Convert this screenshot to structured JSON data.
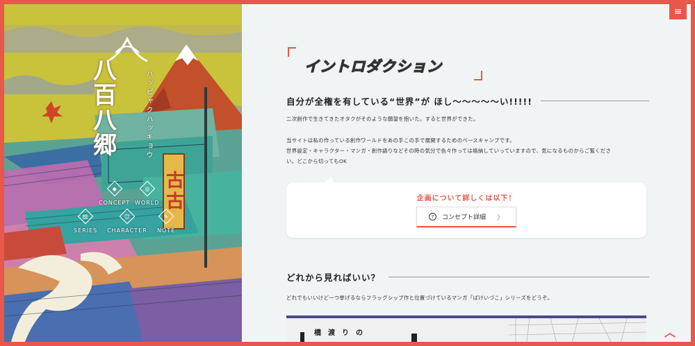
{
  "site": {
    "logo_title": "八百八郷",
    "logo_subtitle": "ぶらり創作徒然記",
    "logo_reading": "ハッピャクハッキョウ"
  },
  "nav": {
    "items": [
      {
        "label": "CONCEPT",
        "icon": "concept-icon"
      },
      {
        "label": "WORLD",
        "icon": "world-icon"
      },
      {
        "label": "SERIES",
        "icon": "series-icon"
      },
      {
        "label": "CHARACTER",
        "icon": "character-icon"
      },
      {
        "label": "NOTE",
        "icon": "note-icon"
      }
    ],
    "menu_icon": "≡"
  },
  "art": {
    "sign_text": "古古"
  },
  "main": {
    "page_title": "イントロダクション",
    "section1": {
      "heading": "自分が全権を有している“世界”が ほし～～～～～い!!!!!",
      "p1": "二次創作で生きてきたオタクがそのような願望を抱いた。すると世界ができた。",
      "p2a": "当サイトは私の作っている創作ワールドをあの手この手で展開するためのベースキャンプです。",
      "p2b": "世界設定・キャラクター・マンガ・創作語りなどその時の気分で色々作っては格納していっていますので、気になるものからご覧くださ",
      "p2c": "い。どこから切ってもOK"
    },
    "card": {
      "title": "企画について詳しくは以下！",
      "button_label": "コンセプト詳細",
      "button_icon": "?",
      "chevron": "〉"
    },
    "section2": {
      "heading": "どれから見ればいい？",
      "p1": "どれでもいいけど一つ挙げるならフラッグシップ作と位置づけているマンガ「ばけいづこ」シリーズをどうぞ。"
    },
    "banner": {
      "title": "橋渡りの"
    }
  },
  "colors": {
    "accent": "#e8574a",
    "bg": "#f1f4f5",
    "banner_bar": "#4a4a8a"
  },
  "scroll_top_icon": "︿"
}
